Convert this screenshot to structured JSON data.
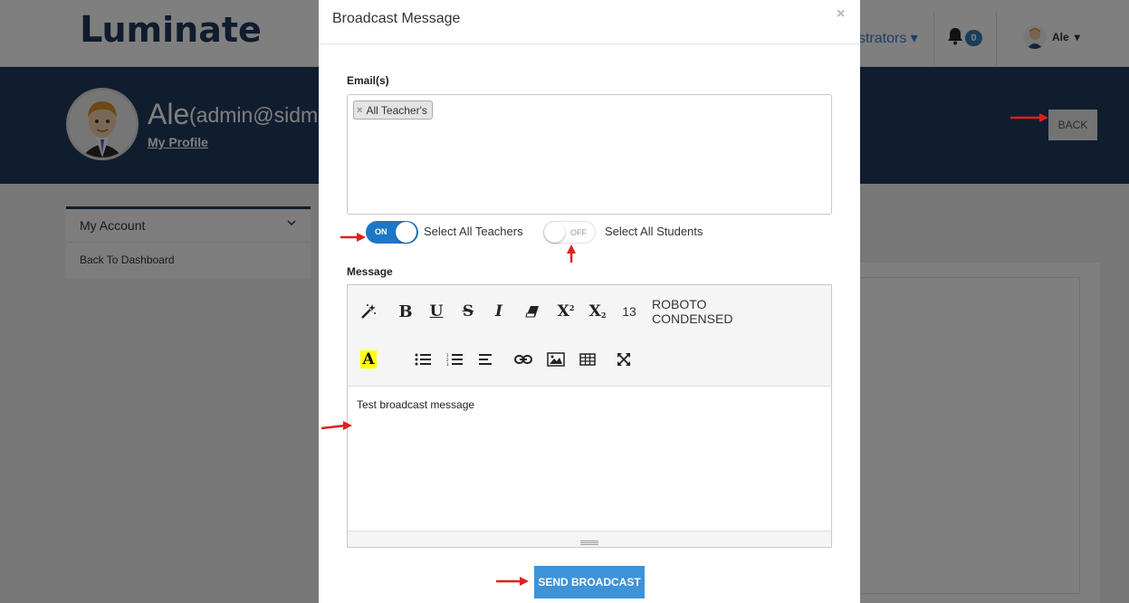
{
  "app": {
    "logo_text": "uminate",
    "logo_mark": "L"
  },
  "nav": {
    "administrators_label": "strators",
    "dropdown_caret": "▾",
    "notification_count": "0",
    "user_name": "Ale",
    "user_caret": "▾"
  },
  "profile": {
    "name": "Ale",
    "email": "(admin@sidmac",
    "link": "My Profile",
    "back_label": "BACK"
  },
  "sidebar": {
    "heading": "My Account",
    "chevron": "⌄",
    "items": [
      {
        "label": "Back To Dashboard"
      }
    ]
  },
  "modal": {
    "title": "Broadcast Message",
    "close": "×",
    "emails_label": "Email(s)",
    "tags": [
      {
        "remove": "×",
        "label": "All Teacher's"
      }
    ],
    "toggles": [
      {
        "state": "ON",
        "label": "Select All Teachers",
        "checked": true
      },
      {
        "state": "OFF",
        "label": "Select All Students",
        "checked": false
      }
    ],
    "message_label": "Message",
    "toolbar": {
      "font_size": "13",
      "font_family": "ROBOTO CONDENSED",
      "buttons": [
        "magic-icon",
        "bold-icon",
        "underline-icon",
        "strikethrough-icon",
        "italic-icon",
        "eraser-icon",
        "superscript-icon",
        "subscript-icon",
        "highlight-icon",
        "unordered-list-icon",
        "ordered-list-icon",
        "align-icon",
        "link-icon",
        "image-icon",
        "table-icon",
        "fullscreen-icon"
      ]
    },
    "message_value": "Test broadcast message",
    "send_label": "SEND BROADCAST"
  },
  "colors": {
    "header_bg": "#203a5f",
    "primary": "#1d77c8",
    "send_button": "#3d93d8",
    "annotation_arrow": "#e0201c"
  }
}
